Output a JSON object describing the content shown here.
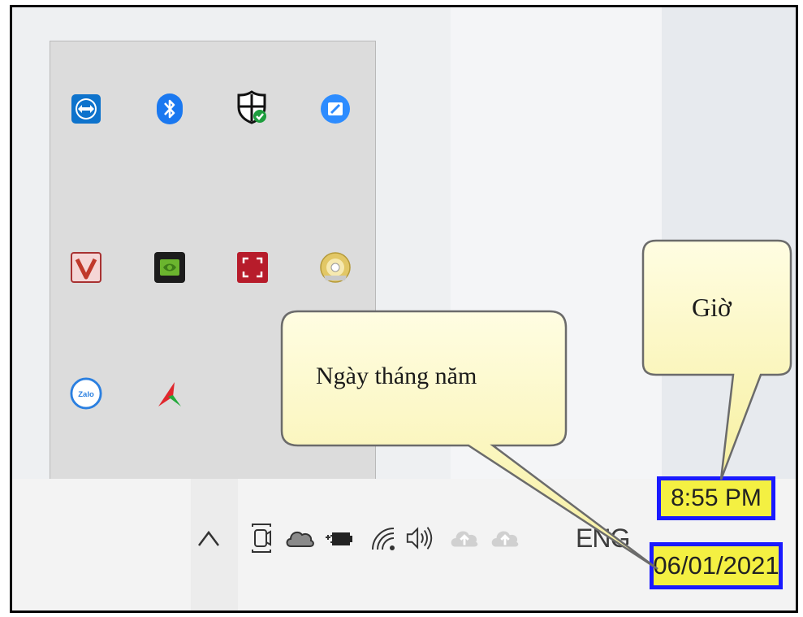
{
  "tray_overflow": {
    "icons": [
      "teamviewer-icon",
      "bluetooth-icon",
      "windows-security-icon",
      "zoom-icon",
      "vietkey-icon",
      "nvidia-icon",
      "screen-capture-icon",
      "disc-drive-icon",
      "zalo-icon",
      "app-red-green-icon"
    ]
  },
  "taskbar": {
    "icons": [
      "chevron-up-icon",
      "camera-privacy-icon",
      "onedrive-icon",
      "battery-charging-icon",
      "wifi-icon",
      "speaker-icon",
      "cloud-upload-icon",
      "cloud-upload-icon"
    ],
    "language": "ENG",
    "time": "8:55 PM",
    "date": "06/01/2021"
  },
  "callouts": {
    "time_label": "Giờ",
    "date_label": "Ngày tháng năm"
  },
  "colors": {
    "highlight_fill": "#f4f042",
    "highlight_border": "#1a1aff",
    "callout_fill": "#fffbc2"
  }
}
